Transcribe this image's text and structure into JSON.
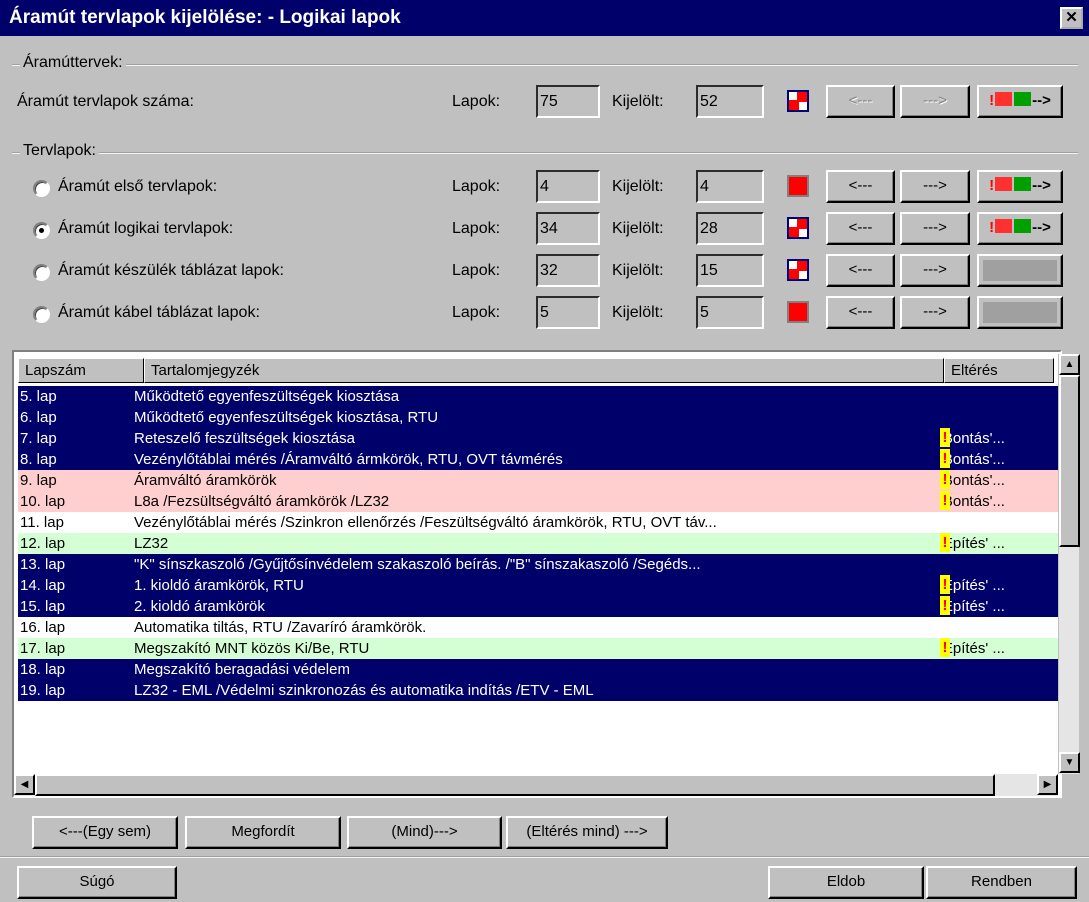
{
  "window": {
    "title": "Áramút tervlapok kijelölése: - Logikai lapok",
    "close": "✕"
  },
  "group1": {
    "title": "Áramúttervek:",
    "row": {
      "label": "Áramút tervlapok száma:",
      "lapok_label": "Lapok:",
      "lapok": "75",
      "kijelolt_label": "Kijelölt:",
      "kijelolt": "52",
      "prev": "<---",
      "next": "--->",
      "mark": "-->"
    }
  },
  "group2": {
    "title": "Tervlapok:",
    "rows": [
      {
        "label": "Áramút első tervlapok:",
        "lapok_label": "Lapok:",
        "lapok": "4",
        "kijelolt_label": "Kijelölt:",
        "kijelolt": "4",
        "prev": "<---",
        "next": "--->",
        "mark": "-->"
      },
      {
        "label": "Áramút logikai tervlapok:",
        "lapok_label": "Lapok:",
        "lapok": "34",
        "kijelolt_label": "Kijelölt:",
        "kijelolt": "28",
        "prev": "<---",
        "next": "--->",
        "mark": "-->"
      },
      {
        "label": "Áramút készülék táblázat lapok:",
        "lapok_label": "Lapok:",
        "lapok": "32",
        "kijelolt_label": "Kijelölt:",
        "kijelolt": "15",
        "prev": "<---",
        "next": "--->"
      },
      {
        "label": "Áramút kábel táblázat lapok:",
        "lapok_label": "Lapok:",
        "lapok": "5",
        "kijelolt_label": "Kijelölt:",
        "kijelolt": "5",
        "prev": "<---",
        "next": "--->"
      }
    ]
  },
  "list": {
    "headers": [
      "Lapszám",
      "Tartalomjegyzék",
      "Eltérés"
    ],
    "rows": [
      {
        "lap": "5. lap",
        "text": "Működtető egyenfeszültségek kiosztása",
        "elt": ""
      },
      {
        "lap": "6. lap",
        "text": "Működtető egyenfeszültségek kiosztása, RTU",
        "elt": ""
      },
      {
        "lap": "7. lap",
        "text": "Reteszelő feszültségek kiosztása",
        "elt": "'Bontás'..."
      },
      {
        "lap": "8. lap",
        "text": "Vezénylőtáblai mérés   /Áramváltó ármkörök, RTU, OVT távmérés",
        "elt": "'Bontás'..."
      },
      {
        "lap": "9. lap",
        "text": "Áramváltó áramkörök",
        "elt": "'Bontás'..."
      },
      {
        "lap": "10. lap",
        "text": "L8a   /Fezsültségváltó áramkörök   /LZ32",
        "elt": "'Bontás'..."
      },
      {
        "lap": "11. lap",
        "text": "Vezénylőtáblai mérés   /Szinkron ellenőrzés   /Feszültségváltó áramkörök, RTU, OVT táv...",
        "elt": ""
      },
      {
        "lap": "12. lap",
        "text": "LZ32",
        "elt": "'Építés' ..."
      },
      {
        "lap": "13. lap",
        "text": "\"K\" sínszkaszoló   /Gyűjtősínvédelem szakaszoló beírás.   /\"B\" sínszakaszoló   /Segéds...",
        "elt": ""
      },
      {
        "lap": "14. lap",
        "text": "1. kioldó áramkörök, RTU",
        "elt": "'Építés' ..."
      },
      {
        "lap": "15. lap",
        "text": "2. kioldó áramkörök",
        "elt": "'Építés' ..."
      },
      {
        "lap": "16. lap",
        "text": "Automatika tiltás, RTU   /Zavaríró áramkörök.",
        "elt": ""
      },
      {
        "lap": "17. lap",
        "text": "Megszakító MNT közös Ki/Be, RTU",
        "elt": "'Építés' ..."
      },
      {
        "lap": "18. lap",
        "text": "Megszakító beragadási védelem",
        "elt": ""
      },
      {
        "lap": "19. lap",
        "text": "LZ32 - EML   /Védelmi szinkronozás és automatika indítás   /ETV - EML",
        "elt": ""
      }
    ]
  },
  "buttons": {
    "none": "<---(Egy sem)",
    "invert": "Megfordít",
    "all": "(Mind)--->",
    "diff_all": "(Eltérés mind) --->",
    "help": "Súgó",
    "discard": "Eldob",
    "ok": "Rendben"
  },
  "warn_mark": "!"
}
